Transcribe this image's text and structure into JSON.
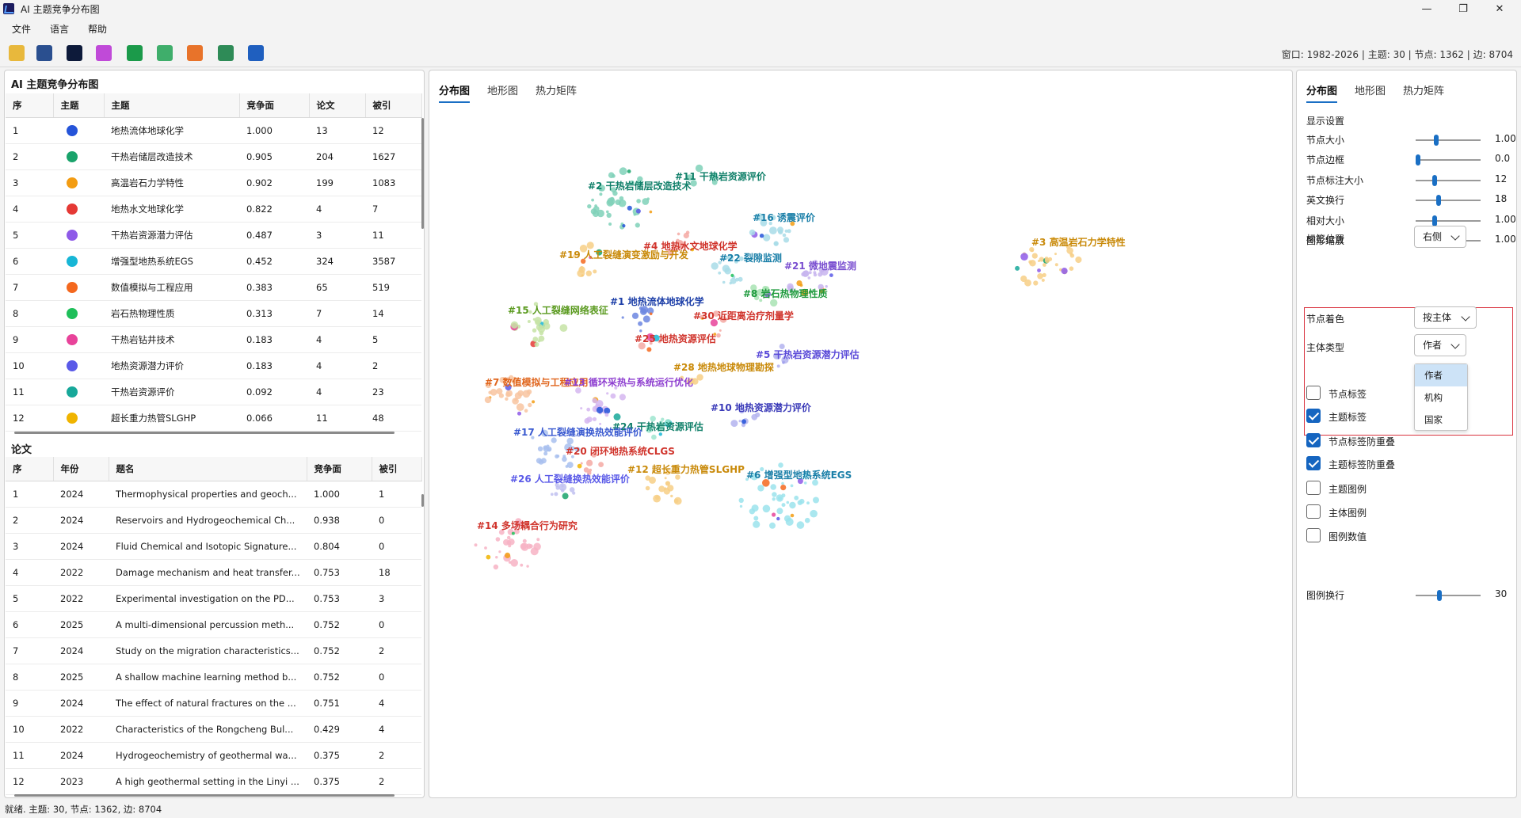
{
  "window": {
    "title": "AI 主题竞争分布图",
    "minimize": "—",
    "maximize": "❐",
    "close": "✕"
  },
  "menu": [
    "文件",
    "语言",
    "帮助"
  ],
  "toolbar": {
    "icons": [
      {
        "name": "open-folder-icon",
        "color": "#e8b83c"
      },
      {
        "name": "save-icon",
        "color": "#2a4f8f"
      },
      {
        "name": "render-dark-icon",
        "color": "#0d1a3a"
      },
      {
        "name": "palette-grid-icon",
        "color": "#c04ad8"
      },
      {
        "name": "heatmap-icon",
        "color": "#1b9a4a"
      },
      {
        "name": "terrain-icon",
        "color": "#3fae6b"
      },
      {
        "name": "globe-icon",
        "color": "#e8732a"
      },
      {
        "name": "export-table-icon",
        "color": "#2e8b57"
      },
      {
        "name": "person-tree-icon",
        "color": "#1f5fbf"
      }
    ],
    "status": "窗口: 1982-2026 | 主题: 30 | 节点: 1362 | 边: 8704"
  },
  "topics_panel": {
    "title": "AI 主题竞争分布图",
    "columns": [
      "序",
      "主题",
      "主题",
      "竞争面",
      "论文",
      "被引"
    ],
    "rows": [
      {
        "idx": "1",
        "color": "#2554d9",
        "name": "地热流体地球化学",
        "score": "1.000",
        "papers": "13",
        "cites": "12"
      },
      {
        "idx": "2",
        "color": "#1aa36b",
        "name": "干热岩储层改造技术",
        "score": "0.905",
        "papers": "204",
        "cites": "1627"
      },
      {
        "idx": "3",
        "color": "#f39c12",
        "name": "高温岩石力学特性",
        "score": "0.902",
        "papers": "199",
        "cites": "1083"
      },
      {
        "idx": "4",
        "color": "#e53935",
        "name": "地热水文地球化学",
        "score": "0.822",
        "papers": "4",
        "cites": "7"
      },
      {
        "idx": "5",
        "color": "#8e5ae8",
        "name": "干热岩资源潜力评估",
        "score": "0.487",
        "papers": "3",
        "cites": "11"
      },
      {
        "idx": "6",
        "color": "#17b6d6",
        "name": "增强型地热系统EGS",
        "score": "0.452",
        "papers": "324",
        "cites": "3587"
      },
      {
        "idx": "7",
        "color": "#f4681e",
        "name": "数值模拟与工程应用",
        "score": "0.383",
        "papers": "65",
        "cites": "519"
      },
      {
        "idx": "8",
        "color": "#1fbf5a",
        "name": "岩石热物理性质",
        "score": "0.313",
        "papers": "7",
        "cites": "14"
      },
      {
        "idx": "9",
        "color": "#e8439a",
        "name": "干热岩钻井技术",
        "score": "0.183",
        "papers": "4",
        "cites": "5"
      },
      {
        "idx": "10",
        "color": "#5a5ae8",
        "name": "地热资源潜力评价",
        "score": "0.183",
        "papers": "4",
        "cites": "2"
      },
      {
        "idx": "11",
        "color": "#17a89a",
        "name": "干热岩资源评价",
        "score": "0.092",
        "papers": "4",
        "cites": "23"
      },
      {
        "idx": "12",
        "color": "#f0b400",
        "name": "超长重力热管SLGHP",
        "score": "0.066",
        "papers": "11",
        "cites": "48"
      }
    ]
  },
  "papers_panel": {
    "title": "论文",
    "columns": [
      "序",
      "年份",
      "题名",
      "竞争面",
      "被引"
    ],
    "rows": [
      {
        "idx": "1",
        "year": "2024",
        "title": "Thermophysical properties and geoch...",
        "score": "1.000",
        "cites": "1"
      },
      {
        "idx": "2",
        "year": "2024",
        "title": "Reservoirs and Hydrogeochemical Ch...",
        "score": "0.938",
        "cites": "0"
      },
      {
        "idx": "3",
        "year": "2024",
        "title": "Fluid Chemical and Isotopic Signature...",
        "score": "0.804",
        "cites": "0"
      },
      {
        "idx": "4",
        "year": "2022",
        "title": "Damage mechanism and heat transfer...",
        "score": "0.753",
        "cites": "18"
      },
      {
        "idx": "5",
        "year": "2022",
        "title": "Experimental investigation on the PD...",
        "score": "0.753",
        "cites": "3"
      },
      {
        "idx": "6",
        "year": "2025",
        "title": "A multi-dimensional percussion meth...",
        "score": "0.752",
        "cites": "0"
      },
      {
        "idx": "7",
        "year": "2024",
        "title": "Study on the migration characteristics...",
        "score": "0.752",
        "cites": "2"
      },
      {
        "idx": "8",
        "year": "2025",
        "title": "A shallow machine learning method b...",
        "score": "0.752",
        "cites": "0"
      },
      {
        "idx": "9",
        "year": "2024",
        "title": "The effect of natural fractures on the ...",
        "score": "0.751",
        "cites": "4"
      },
      {
        "idx": "10",
        "year": "2022",
        "title": "Characteristics of the Rongcheng Bul...",
        "score": "0.429",
        "cites": "4"
      },
      {
        "idx": "11",
        "year": "2024",
        "title": "Hydrogeochemistry of geothermal wa...",
        "score": "0.375",
        "cites": "2"
      },
      {
        "idx": "12",
        "year": "2023",
        "title": "A high geothermal setting in the Linyi ...",
        "score": "0.375",
        "cites": "2"
      }
    ]
  },
  "center": {
    "tabs": [
      "分布图",
      "地形图",
      "热力矩阵"
    ],
    "clusters": [
      {
        "label": "#2 干热岩储层改造技术",
        "color": "#11806a"
      },
      {
        "label": "#11 干热岩资源评价",
        "color": "#11806a"
      },
      {
        "label": "#16 诱震评价",
        "color": "#1a7fa8"
      },
      {
        "label": "#3 高温岩石力学特性",
        "color": "#c98a0a"
      },
      {
        "label": "#4 地热水文地球化学",
        "color": "#d0342c"
      },
      {
        "label": "#19 人工裂缝演变激励与开发",
        "color": "#c98a0a"
      },
      {
        "label": "#22 裂隙监测",
        "color": "#1a7fa8"
      },
      {
        "label": "#21 微地震监测",
        "color": "#7a4fd0"
      },
      {
        "label": "#8 岩石热物理性质",
        "color": "#1f9a3e"
      },
      {
        "label": "#15 人工裂缝网络表征",
        "color": "#5a9a1f"
      },
      {
        "label": "#1 地热流体地球化学",
        "color": "#1d3fa8"
      },
      {
        "label": "#30 近距离治疗剂量学",
        "color": "#d0342c"
      },
      {
        "label": "#25 地热资源评估",
        "color": "#d0342c"
      },
      {
        "label": "#5 干热岩资源潜力评估",
        "color": "#5a4ad8"
      },
      {
        "label": "#28 地热地球物理勘探",
        "color": "#c98a0a"
      },
      {
        "label": "#7 数值模拟与工程应用",
        "color": "#e0661e"
      },
      {
        "label": "#13 循环采热与系统运行优化",
        "color": "#8e3fd0"
      },
      {
        "label": "#10 地热资源潜力评价",
        "color": "#3a3ab8"
      },
      {
        "label": "#24 干热岩资源评估",
        "color": "#11806a"
      },
      {
        "label": "#17 人工裂缝演换热效能评价",
        "color": "#3a5ad0"
      },
      {
        "label": "#20 闭环地热系统CLGS",
        "color": "#d0342c"
      },
      {
        "label": "#12 超长重力热管SLGHP",
        "color": "#c98a0a"
      },
      {
        "label": "#6 增强型地热系统EGS",
        "color": "#1a7fa8"
      },
      {
        "label": "#26 人工裂缝换热效能评价",
        "color": "#5a5ae8"
      },
      {
        "label": "#14 多场耦合行为研究",
        "color": "#d0342c"
      }
    ]
  },
  "settings": {
    "tabs": [
      "分布图",
      "地形图",
      "热力矩阵"
    ],
    "section": "显示设置",
    "sliders": [
      {
        "label": "节点大小",
        "value": "1.00",
        "pos": 0.3
      },
      {
        "label": "节点边框",
        "value": "0.0",
        "pos": 0.0
      },
      {
        "label": "节点标注大小",
        "value": "12",
        "pos": 0.28
      },
      {
        "label": "英文换行",
        "value": "18",
        "pos": 0.34
      },
      {
        "label": "相对大小",
        "value": "1.00",
        "pos": 0.28
      },
      {
        "label": "图形缩放",
        "value": "1.00",
        "pos": 0.4
      }
    ],
    "label_position": {
      "label": "标签位置",
      "value": "右侧"
    },
    "node_color": {
      "label": "节点着色",
      "value": "按主体"
    },
    "entity_type": {
      "label": "主体类型",
      "value": "作者",
      "options": [
        "作者",
        "机构",
        "国家"
      ]
    },
    "checkboxes": [
      {
        "label": "节点标签",
        "checked": false
      },
      {
        "label": "主题标签",
        "checked": true
      },
      {
        "label": "节点标签防重叠",
        "checked": true
      },
      {
        "label": "主题标签防重叠",
        "checked": true
      },
      {
        "label": "主题图例",
        "checked": false
      },
      {
        "label": "主体图例",
        "checked": false
      },
      {
        "label": "图例数值",
        "checked": false
      }
    ],
    "legend_wrap": {
      "label": "图例换行",
      "value": "30",
      "pos": 0.35
    }
  },
  "statusbar": "就绪. 主题: 30, 节点: 1362, 边: 8704"
}
